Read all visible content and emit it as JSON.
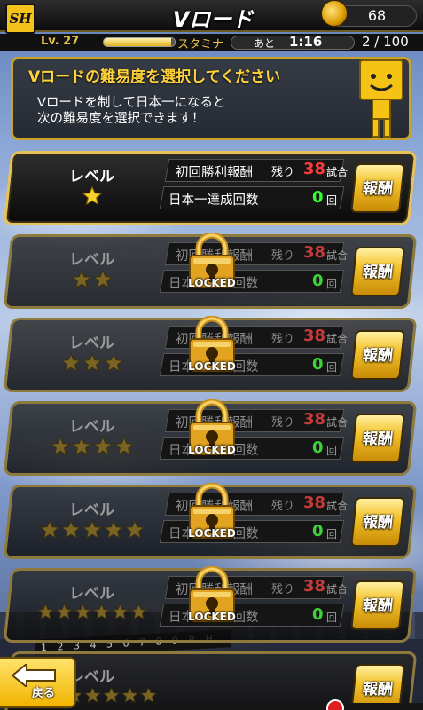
{
  "header": {
    "logo_text": "SH",
    "title": "Vロード",
    "coins": "68"
  },
  "status": {
    "level": "Lv. 27",
    "level_progress": 0.95,
    "stamina_label": "スタミナ",
    "time_prefix": "あと",
    "time_remaining": "1:16",
    "stamina_value": "2 / 100"
  },
  "banner": {
    "title": "Vロードの難易度を選択してください",
    "line1": "Vロードを制して日本一になると",
    "line2": "次の難易度を選択できます！"
  },
  "levels": [
    {
      "label": "レベル",
      "stars": 1,
      "locked": false,
      "first_win_label": "初回勝利報酬",
      "remaining_label": "残り",
      "remaining_count": "38",
      "games_unit": "試合",
      "champion_label": "日本一達成回数",
      "champion_count": "0",
      "times_unit": "回",
      "reward_label": "報酬"
    },
    {
      "label": "レベル",
      "stars": 2,
      "locked": true,
      "first_win_label": "初回勝利報酬",
      "remaining_label": "残り",
      "remaining_count": "38",
      "games_unit": "試合",
      "champion_label": "日本一達成回数",
      "champion_count": "0",
      "times_unit": "回",
      "reward_label": "報酬",
      "locked_label": "LOCKED"
    },
    {
      "label": "レベル",
      "stars": 3,
      "locked": true,
      "first_win_label": "初回勝利報酬",
      "remaining_label": "残り",
      "remaining_count": "38",
      "games_unit": "試合",
      "champion_label": "日本一達成回数",
      "champion_count": "0",
      "times_unit": "回",
      "reward_label": "報酬",
      "locked_label": "LOCKED"
    },
    {
      "label": "レベル",
      "stars": 4,
      "locked": true,
      "first_win_label": "初回勝利報酬",
      "remaining_label": "残り",
      "remaining_count": "38",
      "games_unit": "試合",
      "champion_label": "日本一達成回数",
      "champion_count": "0",
      "times_unit": "回",
      "reward_label": "報酬",
      "locked_label": "LOCKED"
    },
    {
      "label": "レベル",
      "stars": 5,
      "locked": true,
      "first_win_label": "初回勝利報酬",
      "remaining_label": "残り",
      "remaining_count": "38",
      "games_unit": "試合",
      "champion_label": "日本一達成回数",
      "champion_count": "0",
      "times_unit": "回",
      "reward_label": "報酬",
      "locked_label": "LOCKED"
    },
    {
      "label": "レベル",
      "stars": 6,
      "locked": true,
      "first_win_label": "初回勝利報酬",
      "remaining_label": "残り",
      "remaining_count": "38",
      "games_unit": "試合",
      "champion_label": "日本一達成回数",
      "champion_count": "0",
      "times_unit": "回",
      "reward_label": "報酬",
      "locked_label": "LOCKED"
    },
    {
      "label": "レベル",
      "stars": 7,
      "locked": true,
      "reward_label": "報酬"
    }
  ],
  "footer": {
    "back_label": "戻る",
    "scoreboard_text": "1 2 3 4 5 6 7 8 9 R H E"
  },
  "colors": {
    "gold": "#e7c25a",
    "remaining_red": "#ff3a3a",
    "count_green": "#32ff2f",
    "title_yellow": "#ffd23a"
  }
}
